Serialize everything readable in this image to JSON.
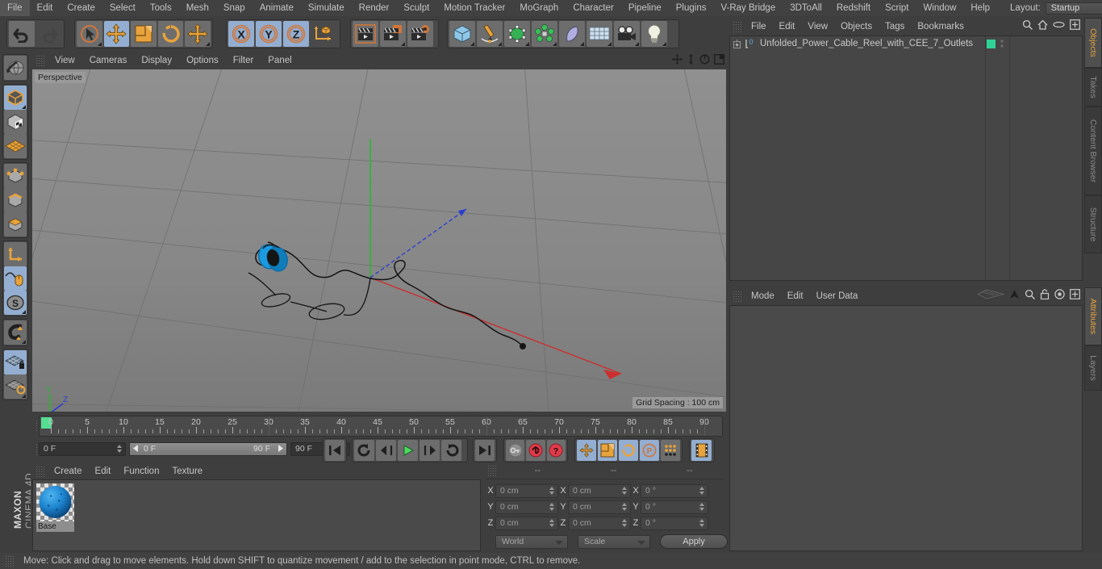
{
  "app": {
    "name": "MAXON CINEMA 4D",
    "brand_line1": "MAXON",
    "brand_line2": "CINEMA 4D"
  },
  "menubar": {
    "items": [
      {
        "label": "File"
      },
      {
        "label": "Edit"
      },
      {
        "label": "Create"
      },
      {
        "label": "Select"
      },
      {
        "label": "Tools"
      },
      {
        "label": "Mesh"
      },
      {
        "label": "Snap"
      },
      {
        "label": "Animate"
      },
      {
        "label": "Simulate"
      },
      {
        "label": "Render"
      },
      {
        "label": "Sculpt"
      },
      {
        "label": "Motion Tracker"
      },
      {
        "label": "MoGraph"
      },
      {
        "label": "Character"
      },
      {
        "label": "Pipeline"
      },
      {
        "label": "Plugins"
      },
      {
        "label": "V-Ray Bridge"
      },
      {
        "label": "3DToAll"
      },
      {
        "label": "Redshift"
      },
      {
        "label": "Script"
      },
      {
        "label": "Window"
      },
      {
        "label": "Help"
      }
    ],
    "layout_label": "Layout:",
    "layout_value": "Startup"
  },
  "toolbar": {
    "groups": [
      {
        "buttons": [
          {
            "name": "undo-button",
            "icon": "undo-arrow-icon",
            "state": "normal"
          },
          {
            "name": "redo-button",
            "icon": "redo-arrow-icon",
            "state": "disabled"
          }
        ]
      },
      {
        "buttons": [
          {
            "name": "live-selection-tool",
            "icon": "cursor-circle-icon",
            "state": "normal"
          },
          {
            "name": "move-tool",
            "icon": "move-cross-icon",
            "state": "selected"
          },
          {
            "name": "scale-tool",
            "icon": "scale-square-icon",
            "state": "normal"
          },
          {
            "name": "rotate-tool",
            "icon": "rotate-arc-icon",
            "state": "normal"
          },
          {
            "name": "move-duplicate-tool",
            "icon": "move-cross-icon",
            "state": "normal"
          }
        ]
      },
      {
        "buttons": [
          {
            "name": "lock-x-axis",
            "icon": "axis-x-icon",
            "state": "selected"
          },
          {
            "name": "lock-y-axis",
            "icon": "axis-y-icon",
            "state": "selected"
          },
          {
            "name": "lock-z-axis",
            "icon": "axis-z-icon",
            "state": "selected"
          },
          {
            "name": "world-object-coordinates",
            "icon": "world-axis-cube-icon",
            "state": "normal"
          }
        ]
      },
      {
        "buttons": [
          {
            "name": "render-view-button",
            "icon": "clapperboard-icon",
            "state": "normal"
          },
          {
            "name": "render-region-button",
            "icon": "clapperboard-region-icon",
            "state": "normal"
          },
          {
            "name": "render-settings-button",
            "icon": "clapperboard-gear-icon",
            "state": "normal"
          }
        ]
      },
      {
        "buttons": [
          {
            "name": "add-cube-object",
            "icon": "cube-icon",
            "state": "normal"
          },
          {
            "name": "add-spline-object",
            "icon": "pen-spline-icon",
            "state": "normal"
          },
          {
            "name": "add-generator-object",
            "icon": "green-cube-icon",
            "state": "normal"
          },
          {
            "name": "add-array-object",
            "icon": "array-cluster-icon",
            "state": "normal"
          },
          {
            "name": "add-deformer-object",
            "icon": "bend-deformer-icon",
            "state": "normal"
          },
          {
            "name": "add-environment-object",
            "icon": "floor-grid-icon",
            "state": "normal"
          },
          {
            "name": "add-camera-object",
            "icon": "camera-icon",
            "state": "normal"
          },
          {
            "name": "add-light-object",
            "icon": "lightbulb-icon",
            "state": "normal"
          }
        ]
      }
    ]
  },
  "leftbar": {
    "groups": [
      {
        "buttons": [
          {
            "name": "undo-view-button",
            "icon": "globe-wire-icon",
            "state": "normal"
          }
        ]
      },
      {
        "buttons": [
          {
            "name": "model-mode",
            "icon": "model-cube-icon",
            "state": "selected"
          },
          {
            "name": "texture-mode",
            "icon": "texture-cube-icon",
            "state": "normal"
          },
          {
            "name": "workplane-mode",
            "icon": "workplane-grid-icon",
            "state": "normal"
          }
        ]
      },
      {
        "buttons": [
          {
            "name": "points-mode",
            "icon": "points-cube-icon",
            "state": "normal"
          },
          {
            "name": "edges-mode",
            "icon": "edges-cube-icon",
            "state": "normal"
          },
          {
            "name": "polygons-mode",
            "icon": "polygons-cube-icon",
            "state": "normal"
          }
        ]
      },
      {
        "buttons": [
          {
            "name": "enable-axis-modification",
            "icon": "axis-l-icon",
            "state": "normal"
          },
          {
            "name": "viewport-solo-single",
            "icon": "mouse-spline-icon",
            "state": "selected"
          },
          {
            "name": "soft-selection",
            "icon": "s-circle-icon",
            "state": "selected"
          }
        ]
      },
      {
        "buttons": [
          {
            "name": "enable-snapping",
            "icon": "magnet-icon",
            "state": "normal"
          }
        ]
      },
      {
        "buttons": [
          {
            "name": "lock-workplane",
            "icon": "grid-lock-icon",
            "state": "selected"
          },
          {
            "name": "workplane-rotate",
            "icon": "grid-rotate-icon",
            "state": "normal"
          }
        ]
      }
    ]
  },
  "viewport": {
    "menu": [
      {
        "label": "View"
      },
      {
        "label": "Cameras"
      },
      {
        "label": "Display"
      },
      {
        "label": "Options"
      },
      {
        "label": "Filter"
      },
      {
        "label": "Panel"
      }
    ],
    "corner_icons": [
      {
        "name": "viewport-pan-icon"
      },
      {
        "name": "viewport-dolly-icon"
      },
      {
        "name": "viewport-rotate-icon"
      },
      {
        "name": "viewport-maximize-icon"
      }
    ],
    "label": "Perspective",
    "grid_spacing": "Grid Spacing : 100 cm",
    "axis_gizmo": {
      "x": "X",
      "y": "Y",
      "z": "Z"
    },
    "scene_description": "Cable reel with unwound cable spline on ground grid",
    "colors": {
      "background_top": "#8d8d8d",
      "background_bottom": "#7c7c7c",
      "grid_line": "#6f6f6f",
      "axis_x": "#cc3333",
      "axis_y": "#33bb33",
      "axis_z": "#3344cc",
      "reel": "#1a9ae0",
      "cable": "#1a1a1a"
    }
  },
  "timeline": {
    "ticks": [
      0,
      5,
      10,
      15,
      20,
      25,
      30,
      35,
      40,
      45,
      50,
      55,
      60,
      65,
      70,
      75,
      80,
      85,
      90
    ],
    "current_frame_top": "0 F",
    "current_frame": "0 F",
    "range_start": "0 F",
    "range_end": "90 F",
    "end_frame": "90 F",
    "playback": [
      {
        "name": "go-to-start-button",
        "icon": "skip-start-icon",
        "state": "normal"
      },
      {
        "name": "play-backwards-loop-button",
        "icon": "loop-arrow-icon",
        "state": "normal"
      },
      {
        "name": "go-to-previous-frame-button",
        "icon": "step-back-icon",
        "state": "normal"
      },
      {
        "name": "play-button",
        "icon": "play-icon",
        "state": "normal"
      },
      {
        "name": "go-to-next-frame-button",
        "icon": "step-forward-icon",
        "state": "normal"
      },
      {
        "name": "loop-button",
        "icon": "loop-return-icon",
        "state": "normal"
      },
      {
        "name": "go-to-end-button",
        "icon": "skip-end-icon",
        "state": "normal"
      }
    ],
    "keyframe_tools": [
      {
        "name": "record-active-objects-button",
        "icon": "key-icon",
        "state": "normal"
      },
      {
        "name": "autokeying-button",
        "icon": "autokey-circle-icon",
        "state": "normal"
      },
      {
        "name": "keyframe-selection-button",
        "icon": "question-circle-icon",
        "state": "normal"
      }
    ],
    "key_filters": [
      {
        "name": "position-key-toggle",
        "icon": "move-cross-icon",
        "state": "selected"
      },
      {
        "name": "scale-key-toggle",
        "icon": "scale-square-icon",
        "state": "selected"
      },
      {
        "name": "rotation-key-toggle",
        "icon": "rotate-arc-icon",
        "state": "selected"
      },
      {
        "name": "parameter-key-toggle",
        "icon": "p-circle-icon",
        "state": "selected"
      },
      {
        "name": "point-level-animation-toggle",
        "icon": "pla-dots-icon",
        "state": "selected"
      }
    ],
    "extra": [
      {
        "name": "timeline-filmstrip-button",
        "icon": "filmstrip-icon",
        "state": "selected"
      }
    ]
  },
  "materials": {
    "menu": [
      {
        "label": "Create"
      },
      {
        "label": "Edit"
      },
      {
        "label": "Function"
      },
      {
        "label": "Texture"
      }
    ],
    "items": [
      {
        "name": "Base",
        "color": "#1678c8"
      }
    ]
  },
  "coordinates": {
    "headers": [
      "--",
      "--",
      "--"
    ],
    "rows": [
      {
        "axis": "X",
        "position": "0 cm",
        "size": "0 cm",
        "rotation": "0 °"
      },
      {
        "axis": "Y",
        "position": "0 cm",
        "size": "0 cm",
        "rotation": "0 °"
      },
      {
        "axis": "Z",
        "position": "0 cm",
        "size": "0 cm",
        "rotation": "0 °"
      }
    ],
    "coord_system": "World",
    "size_mode": "Scale",
    "apply_label": "Apply"
  },
  "objects_panel": {
    "menu": [
      {
        "label": "File"
      },
      {
        "label": "Edit"
      },
      {
        "label": "View"
      },
      {
        "label": "Objects"
      },
      {
        "label": "Tags"
      },
      {
        "label": "Bookmarks"
      }
    ],
    "icons": [
      {
        "name": "search-icon"
      },
      {
        "name": "home-icon"
      },
      {
        "name": "ellipse-icon"
      },
      {
        "name": "new-tab-icon"
      }
    ],
    "rows": [
      {
        "name": "Unfolded_Power_Cable_Reel_with_CEE_7_Outlets",
        "tag_color": "#2fd398",
        "expandable": true,
        "badge": "0"
      }
    ]
  },
  "attributes_panel": {
    "menu": [
      {
        "label": "Mode"
      },
      {
        "label": "Edit"
      },
      {
        "label": "User Data"
      }
    ],
    "icons": [
      {
        "name": "history-plane-icon"
      },
      {
        "name": "pin-arrow-icon"
      },
      {
        "name": "search-icon"
      },
      {
        "name": "lock-icon"
      },
      {
        "name": "target-icon"
      },
      {
        "name": "new-tab-icon"
      }
    ]
  },
  "right_tabs": {
    "top": [
      {
        "label": "Objects",
        "active": true
      },
      {
        "label": "Takes",
        "active": false
      },
      {
        "label": "Content Browser",
        "active": false
      },
      {
        "label": "Structure",
        "active": false
      }
    ],
    "bottom": [
      {
        "label": "Attributes",
        "active": true
      },
      {
        "label": "Layers",
        "active": false
      }
    ]
  },
  "status": {
    "message": "Move: Click and drag to move elements. Hold down SHIFT to quantize movement / add to the selection in point mode, CTRL to remove."
  }
}
